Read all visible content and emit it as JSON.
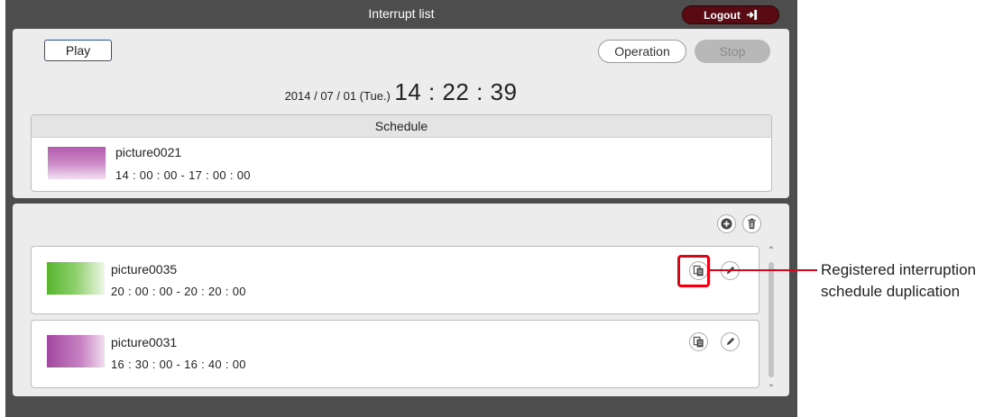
{
  "window": {
    "title": "Interrupt list",
    "logout_label": "Logout"
  },
  "controls": {
    "play_label": "Play",
    "operation_label": "Operation",
    "stop_label": "Stop"
  },
  "clock": {
    "date": "2014 / 07 / 01 (Tue.)",
    "time": "14 : 22 : 39"
  },
  "schedule": {
    "header": "Schedule",
    "item": {
      "name": "picture0021",
      "time_range": "14 : 00 : 00 - 17 : 00 : 00",
      "thumb_color": "#b35aae"
    }
  },
  "interrupts": {
    "items": [
      {
        "name": "picture0035",
        "time_range": "20 : 00 : 00 - 20 : 20 : 00",
        "thumb_color": "#57b530"
      },
      {
        "name": "picture0031",
        "time_range": "16 : 30 : 00 - 16 : 40 : 00",
        "thumb_color": "#a2479f"
      }
    ]
  },
  "icons": {
    "add": "plus-circle-icon",
    "delete": "trash-icon",
    "duplicate": "copy-icon",
    "edit": "pencil-icon",
    "logout": "logout-icon"
  },
  "annotation": {
    "text": "Registered interruption schedule duplication",
    "color": "#e60012"
  }
}
